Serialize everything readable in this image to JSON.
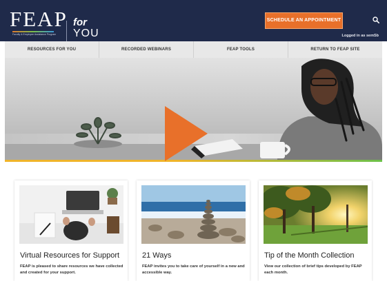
{
  "header": {
    "logo_text": "FEAP",
    "logo_subtitle": "Faculty & Employee Assistance Program",
    "logo_for": "for",
    "logo_you": "YOU",
    "appointment_label": "SCHEDULE AN APPOINTMENT",
    "logged_in_text": "Logged in as semSb"
  },
  "nav": {
    "items": [
      "RESOURCES FOR YOU",
      "RECORDED WEBINARS",
      "FEAP TOOLS",
      "RETURN TO FEAP SITE"
    ]
  },
  "cards": [
    {
      "title": "Virtual Resources for Support",
      "description": "FEAP is pleased to share resources we have collected and created for your support."
    },
    {
      "title": "21 Ways",
      "description": "FEAP invites you to take care of yourself in a new and accessible way."
    },
    {
      "title": "Tip of the Month Collection",
      "description": "View our collection of brief tips developed by FEAP each month."
    }
  ],
  "colors": {
    "header_bg": "#1f2a4a",
    "accent_orange": "#e8702a",
    "nav_bg": "#e8e8e8",
    "hero_stripe_yellow": "#f0b429",
    "hero_stripe_green": "#6cc04a"
  },
  "icons": {
    "search": "search-icon",
    "play": "play-icon"
  }
}
